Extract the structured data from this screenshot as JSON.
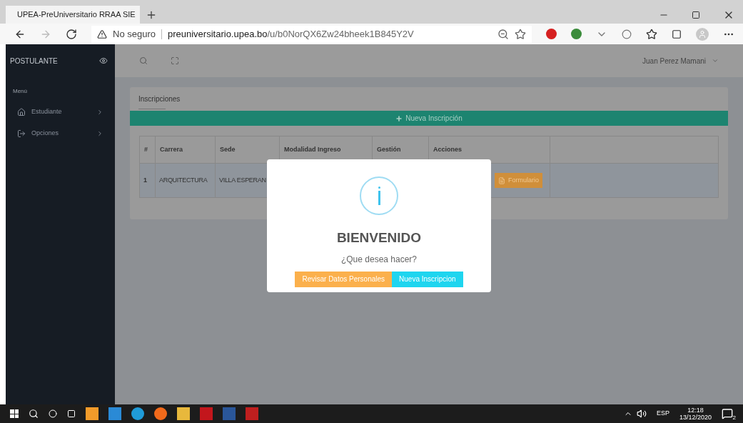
{
  "browser": {
    "tab_title": "UPEA-PreUniversitario RRAA SIE",
    "security": "No seguro",
    "url_host": "preuniversitario.upea.bo",
    "url_path": "/u/b0NorQX6Zw24bheek1B845Y2V"
  },
  "sidebar": {
    "title": "POSTULANTE",
    "section": "Menú",
    "items": [
      {
        "label": "Estudiante",
        "kind": "home"
      },
      {
        "label": "Opciones",
        "kind": "exit"
      }
    ]
  },
  "topbar": {
    "user": "Juan Perez Mamani"
  },
  "card": {
    "title": "Inscripciones",
    "new_button": "Nueva Inscripción",
    "table": {
      "columns": [
        "#",
        "Carrera",
        "Sede",
        "Modalidad Ingreso",
        "Gestión",
        "Acciones"
      ],
      "rows": [
        {
          "cells": [
            "1",
            "ARQUITECTURA",
            "VILLA ESPERAN"
          ],
          "action": "Formulario"
        }
      ]
    }
  },
  "modal": {
    "title": "BIENVENIDO",
    "message": "¿Que desea hacer?",
    "buttons": [
      {
        "label": "Revisar Datos Personales",
        "kind": "warning"
      },
      {
        "label": "Nueva Inscripcion",
        "kind": "info"
      }
    ]
  },
  "taskbar": {
    "language": "ESP",
    "time": "12:18",
    "date": "13/12/2020",
    "notifications": "2"
  }
}
